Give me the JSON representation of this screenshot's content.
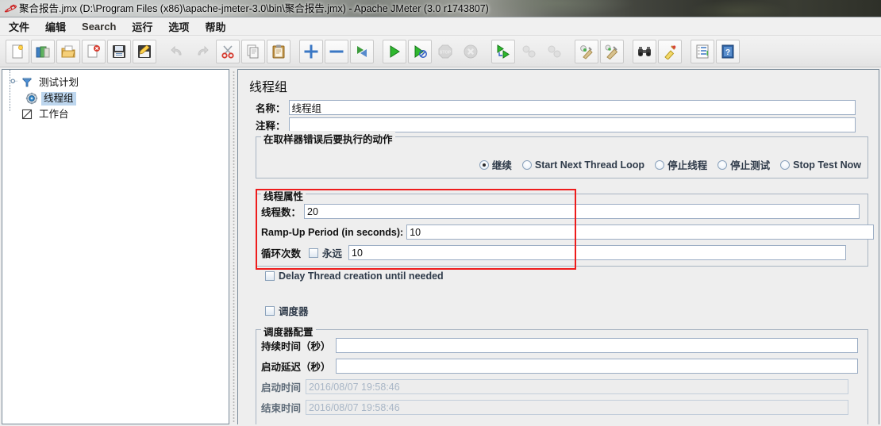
{
  "window": {
    "title": "聚合报告.jmx (D:\\Program Files (x86)\\apache-jmeter-3.0\\bin\\聚合报告.jmx) - Apache JMeter (3.0 r1743807)",
    "app_icon": "jmeter-feather-icon"
  },
  "menubar": {
    "items": [
      {
        "label": "文件",
        "name": "menu-file"
      },
      {
        "label": "编辑",
        "name": "menu-edit"
      },
      {
        "label": "Search",
        "name": "menu-search"
      },
      {
        "label": "运行",
        "name": "menu-run"
      },
      {
        "label": "选项",
        "name": "menu-options"
      },
      {
        "label": "帮助",
        "name": "menu-help"
      }
    ]
  },
  "toolbar": {
    "buttons": [
      {
        "name": "new-button",
        "icon": "new-document-icon",
        "enabled": true
      },
      {
        "name": "templates-button",
        "icon": "templates-icon",
        "enabled": true
      },
      {
        "name": "open-button",
        "icon": "open-folder-icon",
        "enabled": true
      },
      {
        "name": "close-button",
        "icon": "close-document-icon",
        "enabled": true
      },
      {
        "name": "save-button",
        "icon": "save-floppy-icon",
        "enabled": true
      },
      {
        "name": "save-as-button",
        "icon": "save-as-icon",
        "enabled": true
      },
      {
        "name": "separator-1",
        "icon": "separator",
        "enabled": true
      },
      {
        "name": "undo-button",
        "icon": "undo-arrow-icon",
        "enabled": false
      },
      {
        "name": "redo-button",
        "icon": "redo-arrow-icon",
        "enabled": false
      },
      {
        "name": "cut-button",
        "icon": "scissors-icon",
        "enabled": true
      },
      {
        "name": "copy-button",
        "icon": "copy-pages-icon",
        "enabled": true
      },
      {
        "name": "paste-button",
        "icon": "clipboard-icon",
        "enabled": true
      },
      {
        "name": "separator-2",
        "icon": "separator",
        "enabled": true
      },
      {
        "name": "expand-all-button",
        "icon": "plus-icon",
        "enabled": true
      },
      {
        "name": "collapse-all-button",
        "icon": "minus-icon",
        "enabled": true
      },
      {
        "name": "toggle-button",
        "icon": "toggle-arrows-icon",
        "enabled": true
      },
      {
        "name": "separator-3",
        "icon": "separator",
        "enabled": true
      },
      {
        "name": "start-button",
        "icon": "play-green-icon",
        "enabled": true
      },
      {
        "name": "start-no-pause-button",
        "icon": "play-nopause-icon",
        "enabled": true
      },
      {
        "name": "stop-button",
        "icon": "stop-sign-icon",
        "enabled": false
      },
      {
        "name": "shutdown-button",
        "icon": "shutdown-x-icon",
        "enabled": false
      },
      {
        "name": "separator-4",
        "icon": "separator",
        "enabled": true
      },
      {
        "name": "remote-start-all-button",
        "icon": "remote-start-icon",
        "enabled": true
      },
      {
        "name": "remote-stop-all-button",
        "icon": "remote-stop-icon",
        "enabled": false
      },
      {
        "name": "remote-shutdown-all-button",
        "icon": "remote-shutdown-icon",
        "enabled": false
      },
      {
        "name": "separator-5",
        "icon": "separator",
        "enabled": true
      },
      {
        "name": "clear-button",
        "icon": "broom-clear-icon",
        "enabled": true
      },
      {
        "name": "clear-all-button",
        "icon": "broom-clear-all-icon",
        "enabled": true
      },
      {
        "name": "separator-6",
        "icon": "separator",
        "enabled": true
      },
      {
        "name": "search-button",
        "icon": "binoculars-icon",
        "enabled": true
      },
      {
        "name": "reset-search-button",
        "icon": "yellow-broom-icon",
        "enabled": true
      },
      {
        "name": "separator-7",
        "icon": "separator",
        "enabled": true
      },
      {
        "name": "function-helper-button",
        "icon": "function-list-icon",
        "enabled": true
      },
      {
        "name": "help-button",
        "icon": "help-book-icon",
        "enabled": true
      }
    ]
  },
  "tree": {
    "nodes": [
      {
        "label": "测试计划",
        "icon": "test-plan-icon",
        "depth": 0,
        "selected": false,
        "name": "tree-node-test-plan"
      },
      {
        "label": "线程组",
        "icon": "thread-group-gear-icon",
        "depth": 1,
        "selected": true,
        "name": "tree-node-thread-group"
      },
      {
        "label": "工作台",
        "icon": "workbench-icon",
        "depth": 0,
        "selected": false,
        "name": "tree-node-workbench"
      }
    ]
  },
  "panel": {
    "title": "线程组",
    "name_label": "名称：",
    "name_value": "线程组",
    "comments_label": "注释：",
    "comments_value": "",
    "error_action": {
      "legend": "在取样器错误后要执行的动作",
      "options": [
        {
          "label": "继续",
          "selected": true,
          "name": "radio-continue"
        },
        {
          "label": "Start Next Thread Loop",
          "selected": false,
          "name": "radio-start-next-thread-loop"
        },
        {
          "label": "停止线程",
          "selected": false,
          "name": "radio-stop-thread"
        },
        {
          "label": "停止测试",
          "selected": false,
          "name": "radio-stop-test"
        },
        {
          "label": "Stop Test Now",
          "selected": false,
          "name": "radio-stop-test-now"
        }
      ]
    },
    "thread_properties": {
      "legend": "线程属性",
      "threads_label": "线程数：",
      "threads_value": "20",
      "rampup_label": "Ramp-Up Period (in seconds):",
      "rampup_value": "10",
      "loop_label": "循环次数",
      "forever_label": "永远",
      "forever_checked": false,
      "loop_value": "10",
      "highlight_color": "#ee1c1c"
    },
    "delay_creation": {
      "label": "Delay Thread creation until needed",
      "checked": false
    },
    "scheduler_checkbox": {
      "label": "调度器",
      "checked": false
    },
    "scheduler": {
      "legend": "调度器配置",
      "duration_label": "持续时间（秒）",
      "duration_value": "",
      "startup_delay_label": "启动延迟（秒）",
      "startup_delay_value": "",
      "start_time_label": "启动时间",
      "start_time_value": "2016/08/07 19:58:46",
      "end_time_label": "结束时间",
      "end_time_value": "2016/08/07 19:58:46"
    }
  }
}
